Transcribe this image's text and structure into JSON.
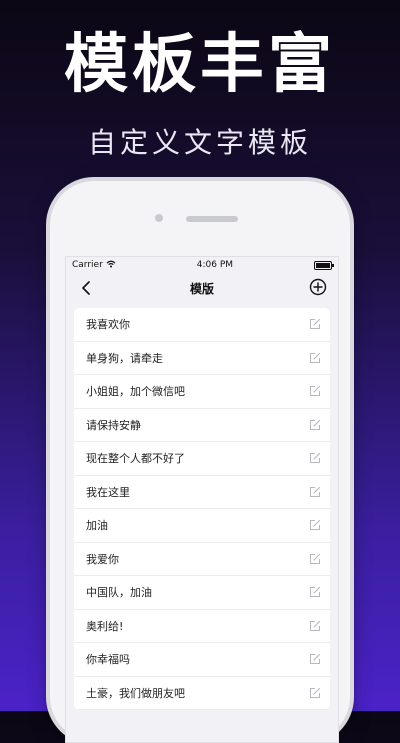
{
  "promo": {
    "headline": "模板丰富",
    "subline": "自定义文字模板"
  },
  "statusbar": {
    "carrier": "Carrier",
    "time": "4:06 PM"
  },
  "navbar": {
    "title": "模版",
    "back_icon": "chevron-left-icon",
    "add_icon": "plus-circle-icon"
  },
  "templates": [
    {
      "text": "我喜欢你"
    },
    {
      "text": "单身狗，请牵走"
    },
    {
      "text": "小姐姐，加个微信吧"
    },
    {
      "text": "请保持安静"
    },
    {
      "text": "现在整个人都不好了"
    },
    {
      "text": "我在这里"
    },
    {
      "text": "加油"
    },
    {
      "text": "我爱你"
    },
    {
      "text": "中国队，加油"
    },
    {
      "text": "奥利给!"
    },
    {
      "text": "你幸福吗"
    },
    {
      "text": "土豪，我们做朋友吧"
    }
  ],
  "colors": {
    "background_top": "#0b0713",
    "background_bottom": "#4b22c9"
  }
}
